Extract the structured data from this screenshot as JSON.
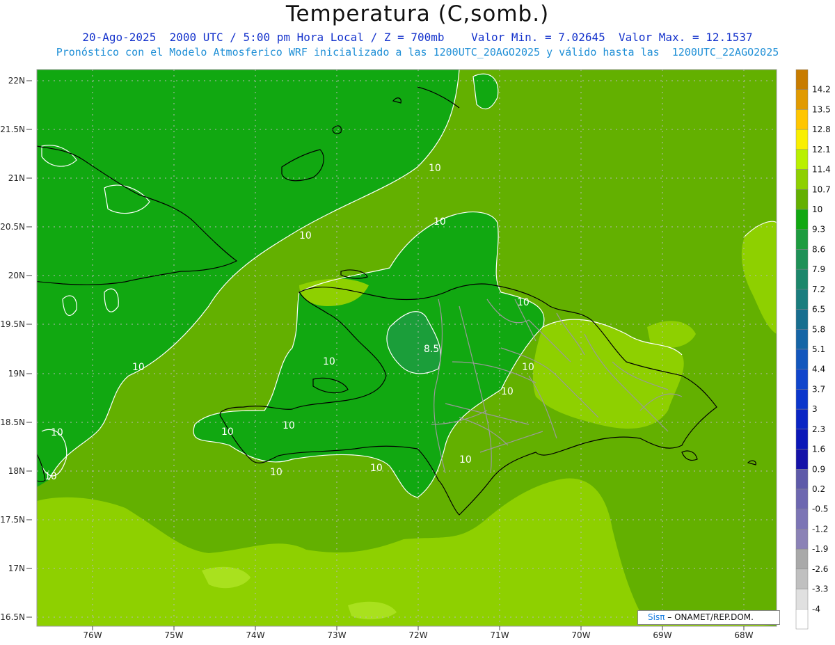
{
  "header": {
    "title": "Temperatura (C,somb.)",
    "subtitle1": "20-Ago-2025  2000 UTC / 5:00 pm Hora Local / Z = 700mb    Valor Min. = 7.02645  Valor Max. = 12.1537",
    "subtitle2": "Pronóstico con el Modelo Atmosferico WRF inicializado a las 1200UTC_20AGO2025 y válido hasta las  1200UTC_22AGO2025"
  },
  "map": {
    "lat_labels": [
      "22N",
      "21.5N",
      "21N",
      "20.5N",
      "20N",
      "19.5N",
      "19N",
      "18.5N",
      "18N",
      "17.5N",
      "17N",
      "16.5N"
    ],
    "lon_labels": [
      "76W",
      "75W",
      "74W",
      "73W",
      "72W",
      "71W",
      "70W",
      "69W",
      "68W"
    ],
    "contour_labels": [
      "10",
      "10",
      "10",
      "10",
      "10",
      "10",
      "10",
      "10",
      "10",
      "10",
      "10",
      "10",
      "10",
      "10",
      "10",
      "8.5"
    ],
    "colors": {
      "t9_3": "#11a811",
      "t10": "#63b000",
      "t10_7": "#8ed000",
      "t11_4": "#a9e11e",
      "t8_6": "#1d9c3f",
      "coast": "#000000",
      "borders": "#9a9a9a",
      "contour": "#ffffff",
      "grid": "#b8b8b8"
    }
  },
  "legend": {
    "labels": [
      "14.2",
      "13.5",
      "12.8",
      "12.1",
      "11.4",
      "10.7",
      "10",
      "9.3",
      "8.6",
      "7.9",
      "7.2",
      "6.5",
      "5.8",
      "5.1",
      "4.4",
      "3.7",
      "3",
      "2.3",
      "1.6",
      "0.9",
      "0.2",
      "-0.5",
      "-1.2",
      "-1.9",
      "-2.6",
      "-3.3",
      "-4"
    ],
    "colors": [
      "#c87c00",
      "#e19a00",
      "#ffc600",
      "#f9ef00",
      "#b9f000",
      "#8ed000",
      "#63b000",
      "#11a811",
      "#1d9c3f",
      "#1e9157",
      "#1c876b",
      "#1a7d7e",
      "#176e8f",
      "#1565a6",
      "#1357bd",
      "#1045cc",
      "#0b36cc",
      "#0a25c4",
      "#0b17b8",
      "#1512a8",
      "#5e5aa9",
      "#6d67b0",
      "#7c75b5",
      "#8b82b6",
      "#a9a9a9",
      "#c0c0c0",
      "#e0e0e0",
      "#ffffff"
    ]
  },
  "credit": {
    "logo": "Sisπ",
    "text": "– ONAMET/REP.DOM."
  }
}
